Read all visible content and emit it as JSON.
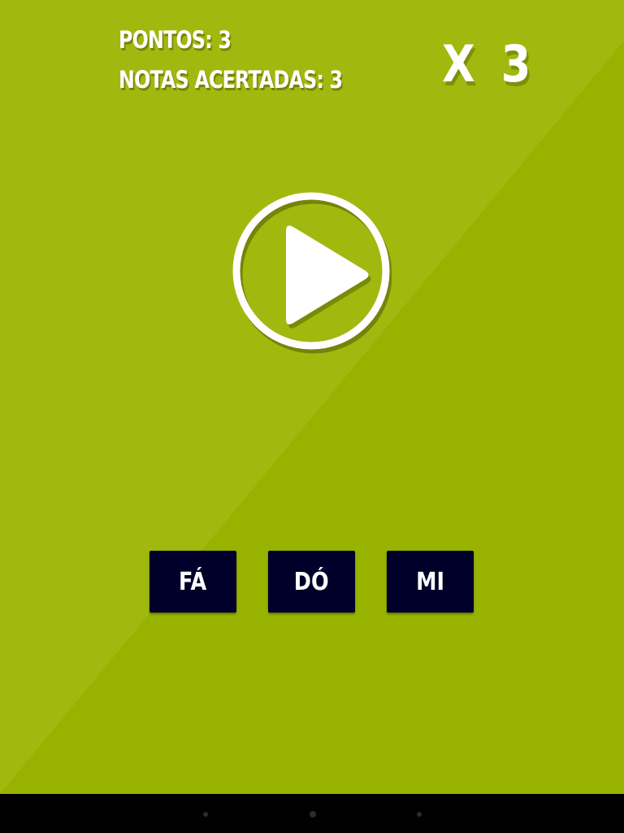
{
  "hud": {
    "points_text": "PONTOS: 3",
    "hits_text": "NOTAS ACERTADAS: 3",
    "multiplier_text": "X 3"
  },
  "play_button": {
    "icon": "play-icon"
  },
  "note_buttons": [
    {
      "label": "FÁ"
    },
    {
      "label": "DÓ"
    },
    {
      "label": "MI"
    }
  ],
  "colors": {
    "background": "#98b200",
    "background_diagonal": "#a1b80e",
    "button_bg": "#00002a",
    "text": "#ffffff"
  },
  "system_nav": {
    "icons": [
      "back-icon",
      "home-icon",
      "recent-apps-icon"
    ]
  }
}
